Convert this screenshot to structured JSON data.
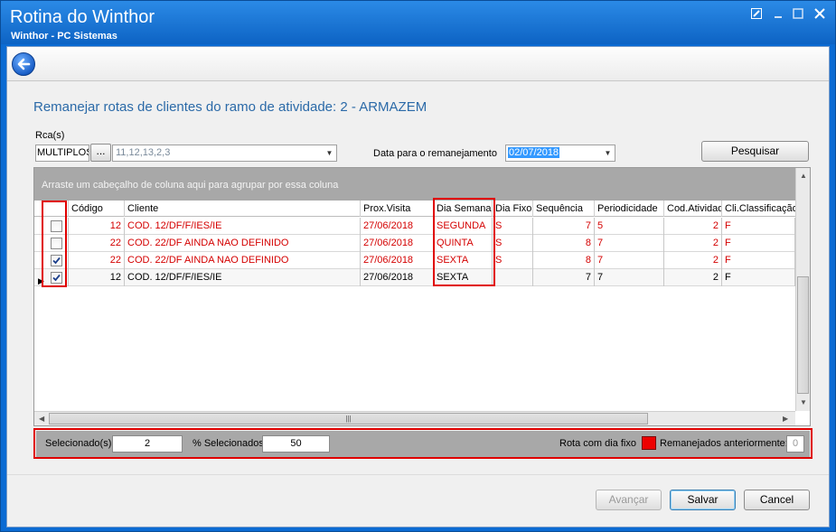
{
  "window": {
    "title": "Rotina do Winthor",
    "subtitle": "Winthor - PC Sistemas"
  },
  "colors": {
    "title_blue": "#0d63c4",
    "page_title": "#2b6aa8",
    "row_red": "#d40000",
    "highlight_border": "#e00000",
    "fixed_day_swatch": "#ee0000",
    "date_selection": "#3399ff"
  },
  "icons": {
    "back": "back-arrow-icon",
    "edit": "edit-icon",
    "minimize": "minimize-icon",
    "maximize": "maximize-icon",
    "close": "close-icon"
  },
  "page": {
    "title": "Remanejar rotas de clientes do ramo de atividade: 2 - ARMAZEM"
  },
  "filters": {
    "rca_label": "Rca(s)",
    "rca_value": "MULTIPLOS",
    "rca_button": "...",
    "rca_list": "11,12,13,2,3",
    "date_label": "Data para o remanejamento",
    "date_value": "02/07/2018",
    "search_button": "Pesquisar"
  },
  "grid": {
    "group_hint": "Arraste um cabeçalho de coluna aqui para agrupar por essa coluna",
    "columns": [
      "Código",
      "Cliente",
      "Prox.Visita",
      "Dia Semana",
      "Dia Fixo",
      "Sequência",
      "Periodicidade",
      "Cod.Atividade",
      "Cli.Classificação"
    ],
    "rows": [
      {
        "checked": false,
        "current": false,
        "red": true,
        "codigo": "12",
        "cliente": "COD. 12/DF/F/IES/IE",
        "prox_visita": "27/06/2018",
        "dia_semana": "SEGUNDA",
        "dia_fixo": "S",
        "sequencia": "7",
        "periodicidade": "5",
        "cod_atividade": "2",
        "classificacao": "F"
      },
      {
        "checked": false,
        "current": false,
        "red": true,
        "codigo": "22",
        "cliente": "COD. 22/DF AINDA NAO DEFINIDO",
        "prox_visita": "27/06/2018",
        "dia_semana": "QUINTA",
        "dia_fixo": "S",
        "sequencia": "8",
        "periodicidade": "7",
        "cod_atividade": "2",
        "classificacao": "F"
      },
      {
        "checked": true,
        "current": false,
        "red": true,
        "codigo": "22",
        "cliente": "COD. 22/DF AINDA NAO DEFINIDO",
        "prox_visita": "27/06/2018",
        "dia_semana": "SEXTA",
        "dia_fixo": "S",
        "sequencia": "8",
        "periodicidade": "7",
        "cod_atividade": "2",
        "classificacao": "F"
      },
      {
        "checked": true,
        "current": true,
        "red": false,
        "codigo": "12",
        "cliente": "COD. 12/DF/F/IES/IE",
        "prox_visita": "27/06/2018",
        "dia_semana": "SEXTA",
        "dia_fixo": "",
        "sequencia": "7",
        "periodicidade": "7",
        "cod_atividade": "2",
        "classificacao": "F"
      }
    ]
  },
  "status": {
    "selected_label": "Selecionado(s)",
    "selected_value": "2",
    "percent_label": "% Selecionados",
    "percent_value": "50",
    "fixed_day_label": "Rota com dia fixo",
    "previous_label": "Remanejados anteriormente:",
    "previous_value": "0"
  },
  "actions": {
    "next": "Avançar",
    "save": "Salvar",
    "cancel": "Cancel"
  }
}
